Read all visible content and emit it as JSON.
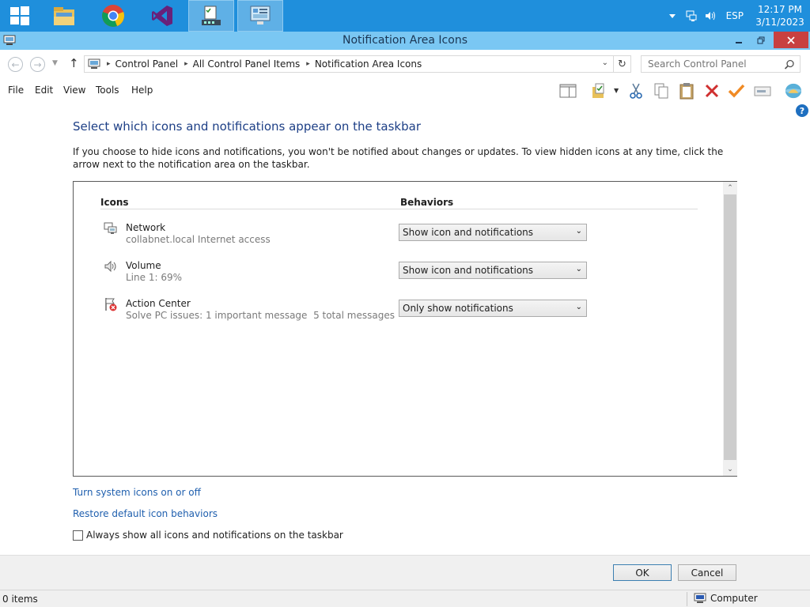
{
  "taskbar": {
    "apps": [
      {
        "name": "start-button",
        "icon": "windows-logo-icon"
      },
      {
        "name": "file-explorer",
        "icon": "folder-icon"
      },
      {
        "name": "chrome",
        "icon": "chrome-icon"
      },
      {
        "name": "visual-studio",
        "icon": "visual-studio-icon"
      },
      {
        "name": "task-manager",
        "icon": "task-manager-icon"
      },
      {
        "name": "control-panel",
        "icon": "control-panel-icon"
      }
    ],
    "tray": {
      "language": "ESP",
      "time": "12:17 PM",
      "date": "3/11/2023"
    }
  },
  "window": {
    "title": "Notification Area Icons"
  },
  "address_bar": {
    "crumbs": [
      "Control Panel",
      "All Control Panel Items",
      "Notification Area Icons"
    ],
    "search_placeholder": "Search Control Panel"
  },
  "menu": {
    "items": [
      "File",
      "Edit",
      "View",
      "Tools",
      "Help"
    ]
  },
  "content": {
    "heading": "Select which icons and notifications appear on the taskbar",
    "intro": "If you choose to hide icons and notifications, you won't be notified about changes or updates. To view hidden icons at any time, click the arrow next to the notification area on the taskbar.",
    "columns": {
      "icons": "Icons",
      "behaviors": "Behaviors"
    },
    "rows": [
      {
        "name": "Network",
        "description": "collabnet.local Internet access",
        "behavior": "Show icon and notifications",
        "icon": "network-icon"
      },
      {
        "name": "Volume",
        "description": "Line 1: 69%",
        "behavior": "Show icon and notifications",
        "icon": "volume-icon"
      },
      {
        "name": "Action Center",
        "description": "Solve PC issues: 1 important message  5 total messages",
        "behavior": "Only show notifications",
        "icon": "action-center-flag-icon"
      }
    ],
    "links": {
      "system_icons": "Turn system icons on or off",
      "restore": "Restore default icon behaviors"
    },
    "always_show_label": "Always show all icons and notifications on the taskbar",
    "always_show_checked": false
  },
  "buttons": {
    "ok": "OK",
    "cancel": "Cancel"
  },
  "status_bar": {
    "items": "0 items",
    "location": "Computer"
  }
}
